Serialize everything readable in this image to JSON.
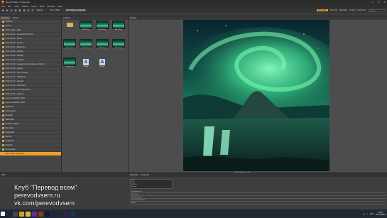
{
  "window": {
    "title": "Work folder composite",
    "minimize": "—",
    "maximize": "☐",
    "close": "✕"
  },
  "menu": [
    "File",
    "Edit",
    "View",
    "Stacks",
    "Label",
    "Tools",
    "Window",
    "Help"
  ],
  "toolbar": {
    "breadcrumbs": [
      "Desktop",
      "Docs & Files",
      "Work folder composite"
    ],
    "workspaces": [
      "Essentials",
      "Filmstrip",
      "Metadata",
      "Output",
      "Keywords"
    ],
    "active_workspace": "Essentials",
    "search_placeholder": "Search"
  },
  "left_panel": {
    "tabs": [
      "Favorites",
      "Folders"
    ],
    "active_tab": "Favorites",
    "folders": [
      "Desktop",
      "Stock 1",
      "2015-10-04 - Milan",
      "2015-10-12 - Aurora Nordic trips",
      "2015-10-14 - Travel",
      "2015-10-19 - Iceland",
      "2015-10-21 - Patagonia",
      "2015-10-24 - Lofoten",
      "2015-10-30 - Norway",
      "2015-11-02 - Scotland",
      "2015-11-05 - Greenland Landscapes collection",
      "2015-11-08 - Alaska",
      "2015-11-10 - Faroe Islands",
      "2015-11-14 - Highlands",
      "2015-11-17 - Canada",
      "2015-11-22 - Dolomites",
      "2015-11-25 - Aurora Borealis",
      "2015-12-01 - Lapland",
      "Aurora Collection 2015",
      "Aurora Collection 2016",
      "Night Sky",
      "Landscapes",
      "Kirkjufell",
      "Waterfalls",
      "Northern Lights",
      "Mountains",
      "Seascapes",
      "Wildlife",
      "Skógafoss",
      "Abstract",
      "Composites",
      "Work folder composite"
    ],
    "selected_folder": "Work folder composite"
  },
  "content": {
    "header": "Content",
    "items": [
      {
        "kind": "folder",
        "caption": ""
      },
      {
        "kind": "aurora",
        "caption": "AUR_001.jpg"
      },
      {
        "kind": "aurora",
        "caption": "AUR_002.jpg"
      },
      {
        "kind": "aurora",
        "caption": "AUR_003.jpg"
      },
      {
        "kind": "aurora",
        "caption": "AUR_004.jpg"
      },
      {
        "kind": "aurora",
        "caption": "AUR_005.jpg"
      },
      {
        "kind": "aurora",
        "caption": "AUR_006.jpg"
      },
      {
        "kind": "aurora",
        "caption": "AUR_007.jpg"
      },
      {
        "kind": "aurora",
        "caption": "Composite.jpg"
      },
      {
        "kind": "doc",
        "caption": "file.psd"
      },
      {
        "kind": "doc",
        "caption": "file.psd"
      }
    ]
  },
  "preview": {
    "header": "Preview",
    "caption": "KirkjufellComposite.jpg"
  },
  "bottom_left": {
    "header": "Filter"
  },
  "bottom_right": {
    "tabs": [
      "Metadata",
      "Keywords"
    ],
    "box_lines": [
      "f/8.0",
      "1/60",
      "ISO 100",
      "24 mm"
    ],
    "rows": [
      "File Properties",
      "IPTC Core",
      "IPTC Extension",
      "Camera Data (Exif)",
      "Audio"
    ]
  },
  "watermark": {
    "line1": "Клуб \"Перевод всем\"",
    "line2": "perevodvsem.ru",
    "line3": "vk.com/perevodvsem"
  },
  "taskbar": {
    "time": "19:57",
    "date": "01.01.2016",
    "lang": "ENG",
    "icons": [
      {
        "name": "search-icon",
        "color": "#1f2a33"
      },
      {
        "name": "task-view-icon",
        "color": "#3a4a5a"
      },
      {
        "name": "chrome-icon",
        "color": "#d9a21a"
      },
      {
        "name": "explorer-icon",
        "color": "#e0b44a"
      },
      {
        "name": "media-icon",
        "color": "#6a2aa0"
      },
      {
        "name": "bridge-icon",
        "color": "#8a3d0e"
      },
      {
        "name": "photoshop-icon",
        "color": "#0b1c3a"
      },
      {
        "name": "premiere-icon",
        "color": "#2a1b40"
      },
      {
        "name": "lightroom-icon",
        "color": "#1e2a38"
      },
      {
        "name": "aftereffects-icon",
        "color": "#3a1b5a"
      },
      {
        "name": "app-icon",
        "color": "#25344a"
      }
    ]
  }
}
